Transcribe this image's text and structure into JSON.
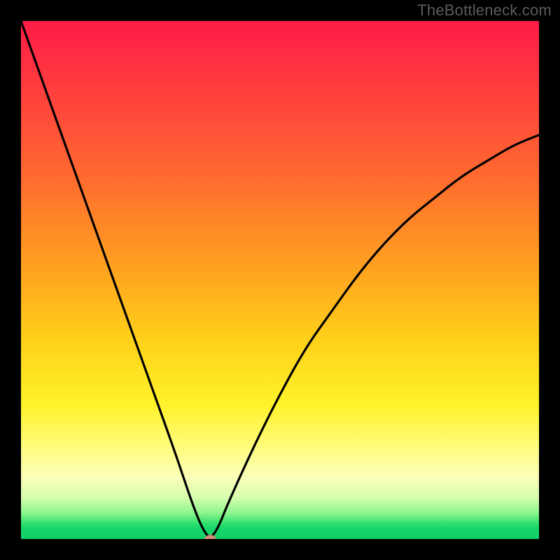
{
  "attribution": "TheBottleneck.com",
  "colors": {
    "top": "#ff1b47",
    "mid": "#ffd21a",
    "bottom": "#0ed066",
    "curve": "#000000",
    "marker": "#d58a7a",
    "background": "#000000"
  },
  "chart_data": {
    "type": "line",
    "title": "",
    "xlabel": "",
    "ylabel": "",
    "xlim": [
      0,
      100
    ],
    "ylim": [
      0,
      100
    ],
    "grid": false,
    "legend": false,
    "series": [
      {
        "name": "bottleneck-curve",
        "x": [
          0,
          5,
          10,
          15,
          20,
          25,
          30,
          33,
          35,
          36.5,
          38,
          40,
          45,
          50,
          55,
          60,
          65,
          70,
          75,
          80,
          85,
          90,
          95,
          100
        ],
        "y": [
          100,
          86,
          72,
          58,
          44,
          30,
          16,
          7,
          2,
          0,
          2,
          7,
          18,
          28,
          37,
          44,
          51,
          57,
          62,
          66,
          70,
          73,
          76,
          78
        ]
      }
    ],
    "annotations": [
      {
        "name": "optimal-marker",
        "x": 36.5,
        "y": 0
      }
    ]
  }
}
